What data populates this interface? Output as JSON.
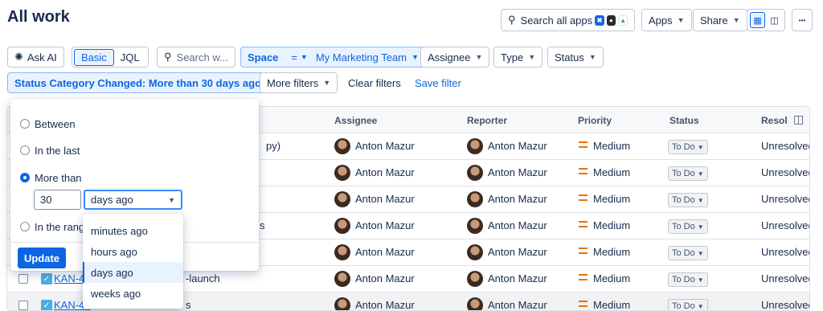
{
  "header": {
    "title": "All work",
    "search_label": "Search all apps",
    "apps_label": "Apps",
    "share_label": "Share",
    "more_label": "•••"
  },
  "filters": {
    "ask_ai": "Ask AI",
    "basic": "Basic",
    "jql": "JQL",
    "search_placeholder": "Search w...",
    "space_label": "Space",
    "space_op": "=",
    "space_value": "My Marketing Team",
    "assignee": "Assignee",
    "type": "Type",
    "status": "Status",
    "status_category": "Status Category Changed: More than 30 days ago",
    "more_filters": "More filters",
    "clear_filters": "Clear filters",
    "save_filter": "Save filter"
  },
  "table": {
    "headers": [
      "Assignee",
      "Reporter",
      "Priority",
      "Status",
      "Resol"
    ],
    "rows": [
      {
        "key": "",
        "summary": "py)",
        "assignee": "Anton Mazur",
        "reporter": "Anton Mazur",
        "priority": "Medium",
        "status": "To Do",
        "resolution": "Unresolved"
      },
      {
        "key": "",
        "summary": "",
        "assignee": "Anton Mazur",
        "reporter": "Anton Mazur",
        "priority": "Medium",
        "status": "To Do",
        "resolution": "Unresolved"
      },
      {
        "key": "",
        "summary": "",
        "assignee": "Anton Mazur",
        "reporter": "Anton Mazur",
        "priority": "Medium",
        "status": "To Do",
        "resolution": "Unresolved"
      },
      {
        "key": "",
        "summary": "s",
        "assignee": "Anton Mazur",
        "reporter": "Anton Mazur",
        "priority": "Medium",
        "status": "To Do",
        "resolution": "Unresolved"
      },
      {
        "key": "",
        "summary": "",
        "assignee": "Anton Mazur",
        "reporter": "Anton Mazur",
        "priority": "Medium",
        "status": "To Do",
        "resolution": "Unresolved"
      },
      {
        "key": "KAN-45",
        "summary": "-launch",
        "assignee": "Anton Mazur",
        "reporter": "Anton Mazur",
        "priority": "Medium",
        "status": "To Do",
        "resolution": "Unresolved"
      },
      {
        "key": "KAN-44",
        "summary": "s",
        "assignee": "Anton Mazur",
        "reporter": "Anton Mazur",
        "priority": "Medium",
        "status": "To Do",
        "resolution": "Unresolved"
      }
    ]
  },
  "popover": {
    "options": [
      "Between",
      "In the last",
      "More than",
      "In the range"
    ],
    "selected": "More than",
    "number_value": "30",
    "unit_value": "days ago",
    "update_label": "Update"
  },
  "unit_dropdown": {
    "options": [
      "minutes ago",
      "hours ago",
      "days ago",
      "weeks ago"
    ],
    "selected": "days ago"
  },
  "colors": {
    "accent": "#0c66e4",
    "priority_medium": "#e2740b"
  }
}
